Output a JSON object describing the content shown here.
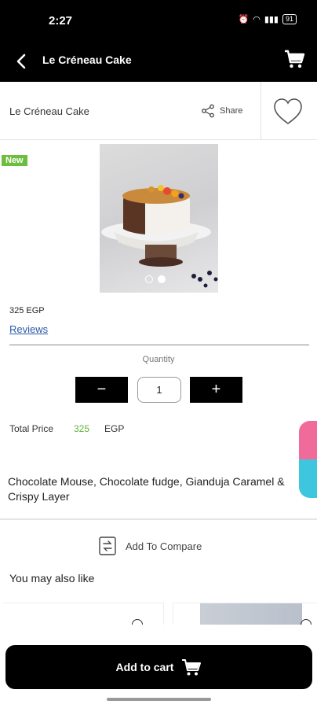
{
  "status_bar": {
    "time": "2:27",
    "battery": "91"
  },
  "app_bar": {
    "title": "Le Créneau Cake",
    "back_icon": "back-icon",
    "cart_icon": "cart-icon"
  },
  "product": {
    "name": "Le Créneau Cake",
    "share_label": "Share",
    "badge": "New",
    "price": "325 EGP",
    "reviews_label": "Reviews",
    "image_count": 2,
    "active_image": 2
  },
  "quantity": {
    "label": "Quantity",
    "minus": "−",
    "value": "1",
    "plus": "+"
  },
  "total": {
    "label": "Total Price",
    "value": "325",
    "currency": "EGP"
  },
  "description": "Chocolate Mouse, Chocolate fudge, Gianduja Caramel & Crispy Layer",
  "compare": {
    "label": "Add To Compare"
  },
  "recommendations": {
    "title": "You may also like"
  },
  "cta": {
    "label": "Add to cart"
  },
  "colors": {
    "accent_green": "#6cbf3e",
    "link_blue": "#2a5aa8",
    "bar_black": "#000000"
  }
}
